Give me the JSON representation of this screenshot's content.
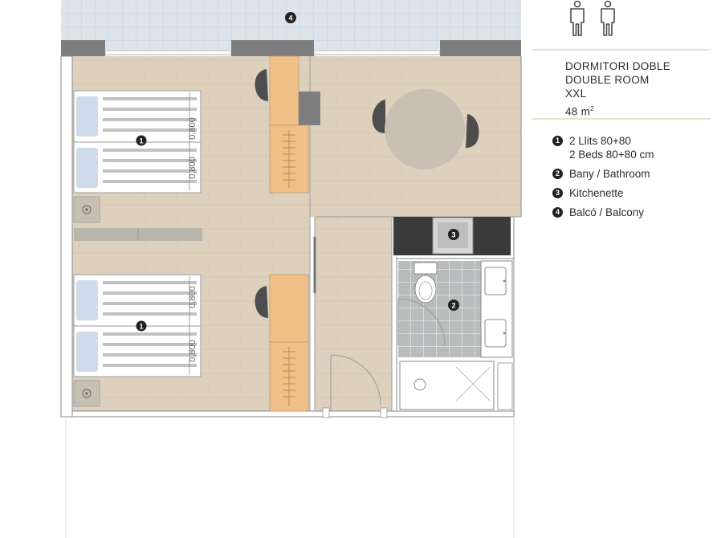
{
  "room": {
    "name_ca": "DORMITORI DOBLE",
    "name_en": "DOUBLE ROOM",
    "size_label": "XXL",
    "area_value": "48 m",
    "area_sup": "2"
  },
  "legend": [
    {
      "num": "1",
      "line1": "2 Llits 80+80",
      "line2": "2 Beds 80+80 cm"
    },
    {
      "num": "2",
      "line1": "Bany / Bathroom",
      "line2": ""
    },
    {
      "num": "3",
      "line1": "Kitchenette",
      "line2": ""
    },
    {
      "num": "4",
      "line1": "Balcó / Balcony",
      "line2": ""
    }
  ],
  "plan_markers": {
    "balcony": "4",
    "bed_top": "1",
    "bed_bottom": "1",
    "bathroom": "2",
    "kitchenette": "3"
  },
  "bed_dimension": "0,800",
  "colors": {
    "wood": "#ddd1bd",
    "balcony_tile": "#dde4ec",
    "wall": "#7e7e7e",
    "desk": "#efc189",
    "marker": "#222222",
    "divider": "#e7e1cf"
  }
}
